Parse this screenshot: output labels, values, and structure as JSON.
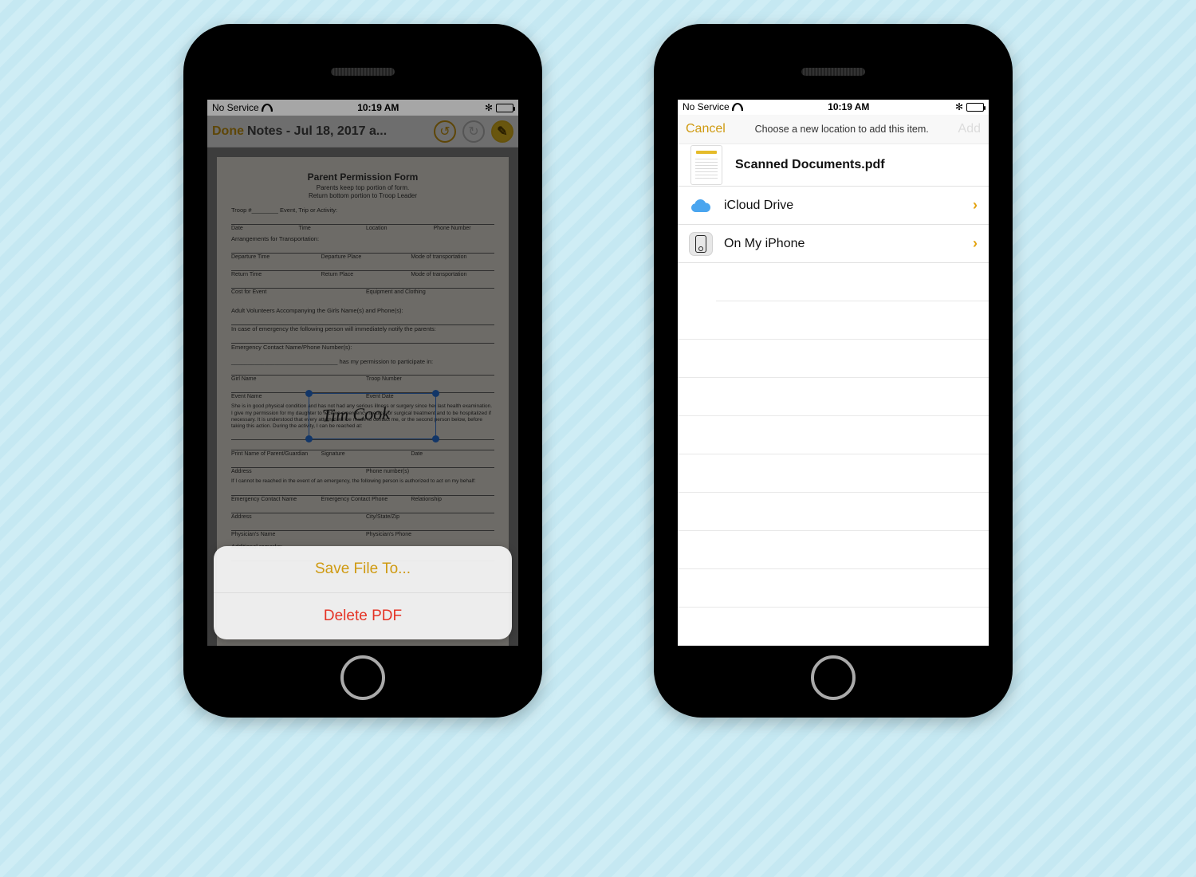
{
  "status": {
    "carrier": "No Service",
    "time": "10:19 AM",
    "bt": "✻"
  },
  "phoneA": {
    "done": "Done",
    "title": "Notes - Jul 18, 2017 a...",
    "doc": {
      "heading": "Parent Permission Form",
      "sub1": "Parents keep top portion of form.",
      "sub2": "Return bottom portion to Troop Leader",
      "troop": "Troop #________  Event, Trip or Activity:",
      "row1": [
        "Date",
        "Time",
        "Location",
        "Phone Number"
      ],
      "arr": "Arrangements for Transportation:",
      "row2": [
        "Departure Time",
        "Departure Place",
        "Mode of transportation"
      ],
      "row3": [
        "Return Time",
        "Return Place",
        "Mode of transportation"
      ],
      "row4": [
        "Cost for Event",
        "Equipment and Clothing"
      ],
      "adult": "Adult Volunteers Accompanying the Girls Name(s) and Phone(s):",
      "emerg": "In case of emergency the following person will immediately notify the parents:",
      "econtact": "Emergency Contact Name/Phone Number(s):",
      "perm": "________________________________ has my permission to participate in:",
      "row5": [
        "Girl Name",
        "Troop Number"
      ],
      "row6": [
        "Event Name",
        "Event Date"
      ],
      "para": "She is in good physical condition and has not had any serious illness or surgery since her last health examination. I give my permission for my daughter to receive emergency medical or surgical treatment and to be hospitalized if necessary. It is understood that every attempt will be made to contact me, or the second person below, before taking this action. During the activity, I can be reached at:",
      "row7": [
        "Print Name of Parent/Guardian",
        "Signature",
        "Date"
      ],
      "row8": [
        "Address",
        "Phone number(s)"
      ],
      "reach": "If I cannot be reached in the event of an emergency, the following person is authorized to act on my behalf:",
      "row9": [
        "Emergency Contact Name",
        "Emergency Contact Phone",
        "Relationship"
      ],
      "row10": [
        "Address",
        "City/State/Zip"
      ],
      "row11": [
        "Physician's Name",
        "Physician's Phone"
      ],
      "remarks": "Additional remarks:",
      "signature": "Tim Cook"
    },
    "sheet": {
      "save": "Save File To...",
      "delete": "Delete PDF"
    }
  },
  "phoneB": {
    "cancel": "Cancel",
    "prompt": "Choose a new location to add this item.",
    "add": "Add",
    "filename": "Scanned Documents.pdf",
    "locations": [
      {
        "label": "iCloud Drive"
      },
      {
        "label": "On My iPhone"
      }
    ]
  }
}
